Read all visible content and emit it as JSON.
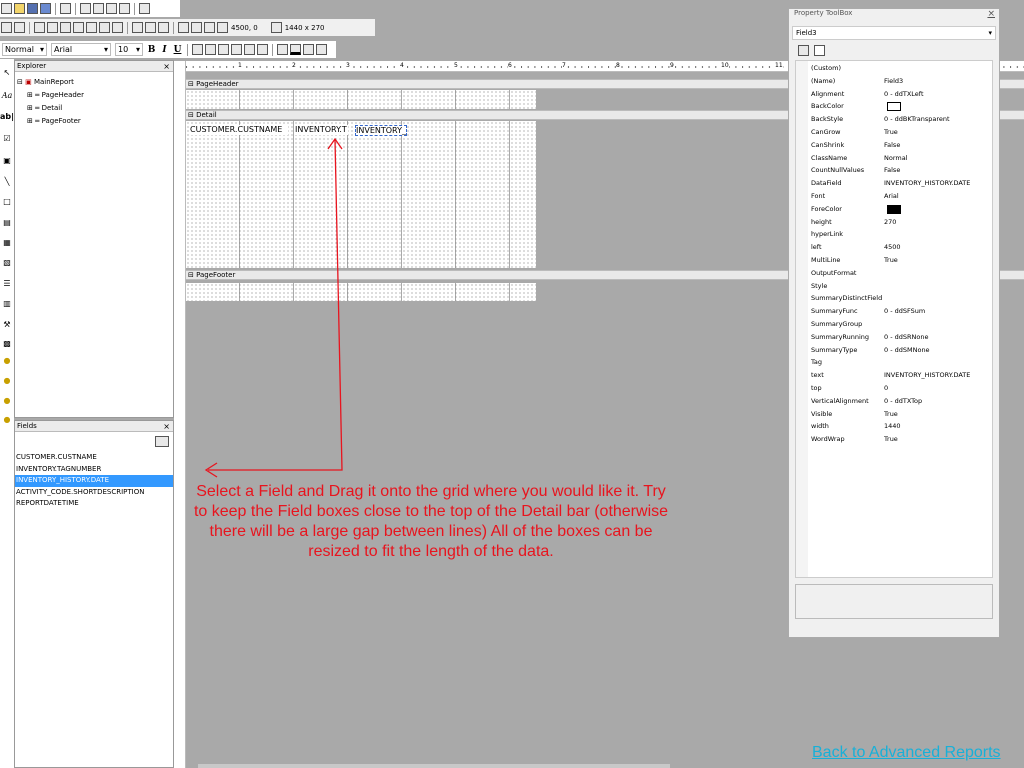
{
  "toolbar": {
    "style_value": "Normal",
    "font_value": "Arial",
    "size_value": "10",
    "bold_label": "B",
    "italic_label": "I",
    "underline_label": "U",
    "position_readout": "4500, 0",
    "size_readout": "1440 x 270"
  },
  "explorer": {
    "title": "Explorer",
    "close": "×",
    "items": [
      "MainReport",
      "PageHeader",
      "Detail",
      "PageFooter"
    ]
  },
  "fields_panel": {
    "title": "Fields",
    "close": "×",
    "items": [
      "CUSTOMER.CUSTNAME",
      "INVENTORY.TAGNUMBER",
      "INVENTORY_HISTORY.DATE",
      "ACTIVITY_CODE.SHORTDESCRIPTION",
      "REPORTDATETIME"
    ],
    "selected_index": 2
  },
  "ruler": {
    "labels": [
      "1",
      "2",
      "3",
      "4",
      "5",
      "6",
      "7",
      "8",
      "9",
      "10",
      "11"
    ]
  },
  "report": {
    "page_header": "PageHeader",
    "detail": "Detail",
    "page_footer": "PageFooter",
    "fields": [
      "CUSTOMER.CUSTNAME",
      "INVENTORY.T",
      "INVENTORY_"
    ]
  },
  "toolbox": {
    "title": "Property ToolBox",
    "close": "×",
    "selected_object": "Field3",
    "properties": [
      [
        "(Custom)",
        ""
      ],
      [
        "(Name)",
        "Field3"
      ],
      [
        "Alignment",
        "0 - ddTXLeft"
      ],
      [
        "BackColor",
        ""
      ],
      [
        "BackStyle",
        "0 - ddBKTransparent"
      ],
      [
        "CanGrow",
        "True"
      ],
      [
        "CanShrink",
        "False"
      ],
      [
        "ClassName",
        "Normal"
      ],
      [
        "CountNullValues",
        "False"
      ],
      [
        "DataField",
        "INVENTORY_HISTORY.DATE"
      ],
      [
        "Font",
        "Arial"
      ],
      [
        "ForeColor",
        ""
      ],
      [
        "height",
        "270"
      ],
      [
        "hyperLink",
        ""
      ],
      [
        "left",
        "4500"
      ],
      [
        "MultiLine",
        "True"
      ],
      [
        "OutputFormat",
        ""
      ],
      [
        "Style",
        ""
      ],
      [
        "SummaryDistinctField",
        ""
      ],
      [
        "SummaryFunc",
        "0 - ddSFSum"
      ],
      [
        "SummaryGroup",
        ""
      ],
      [
        "SummaryRunning",
        "0 - ddSRNone"
      ],
      [
        "SummaryType",
        "0 - ddSMNone"
      ],
      [
        "Tag",
        ""
      ],
      [
        "text",
        "INVENTORY_HISTORY.DATE"
      ],
      [
        "top",
        "0"
      ],
      [
        "VerticalAlignment",
        "0 - ddTXTop"
      ],
      [
        "Visible",
        "True"
      ],
      [
        "width",
        "1440"
      ],
      [
        "WordWrap",
        "True"
      ]
    ],
    "backcolor_swatch": "#ffffff",
    "forecolor_swatch": "#000000"
  },
  "annotation": {
    "text": "Select a Field and Drag it onto the grid where you would like it. Try to keep the Field boxes close to the top of the Detail bar (otherwise there will be a large gap between lines) All of the boxes can be resized to fit the length of the data.",
    "color": "#e8141e"
  },
  "back_link": "Back to Advanced Reports",
  "colors": {
    "link": "#18b0d8",
    "selection": "#3399ff",
    "annotation": "#e8141e"
  }
}
